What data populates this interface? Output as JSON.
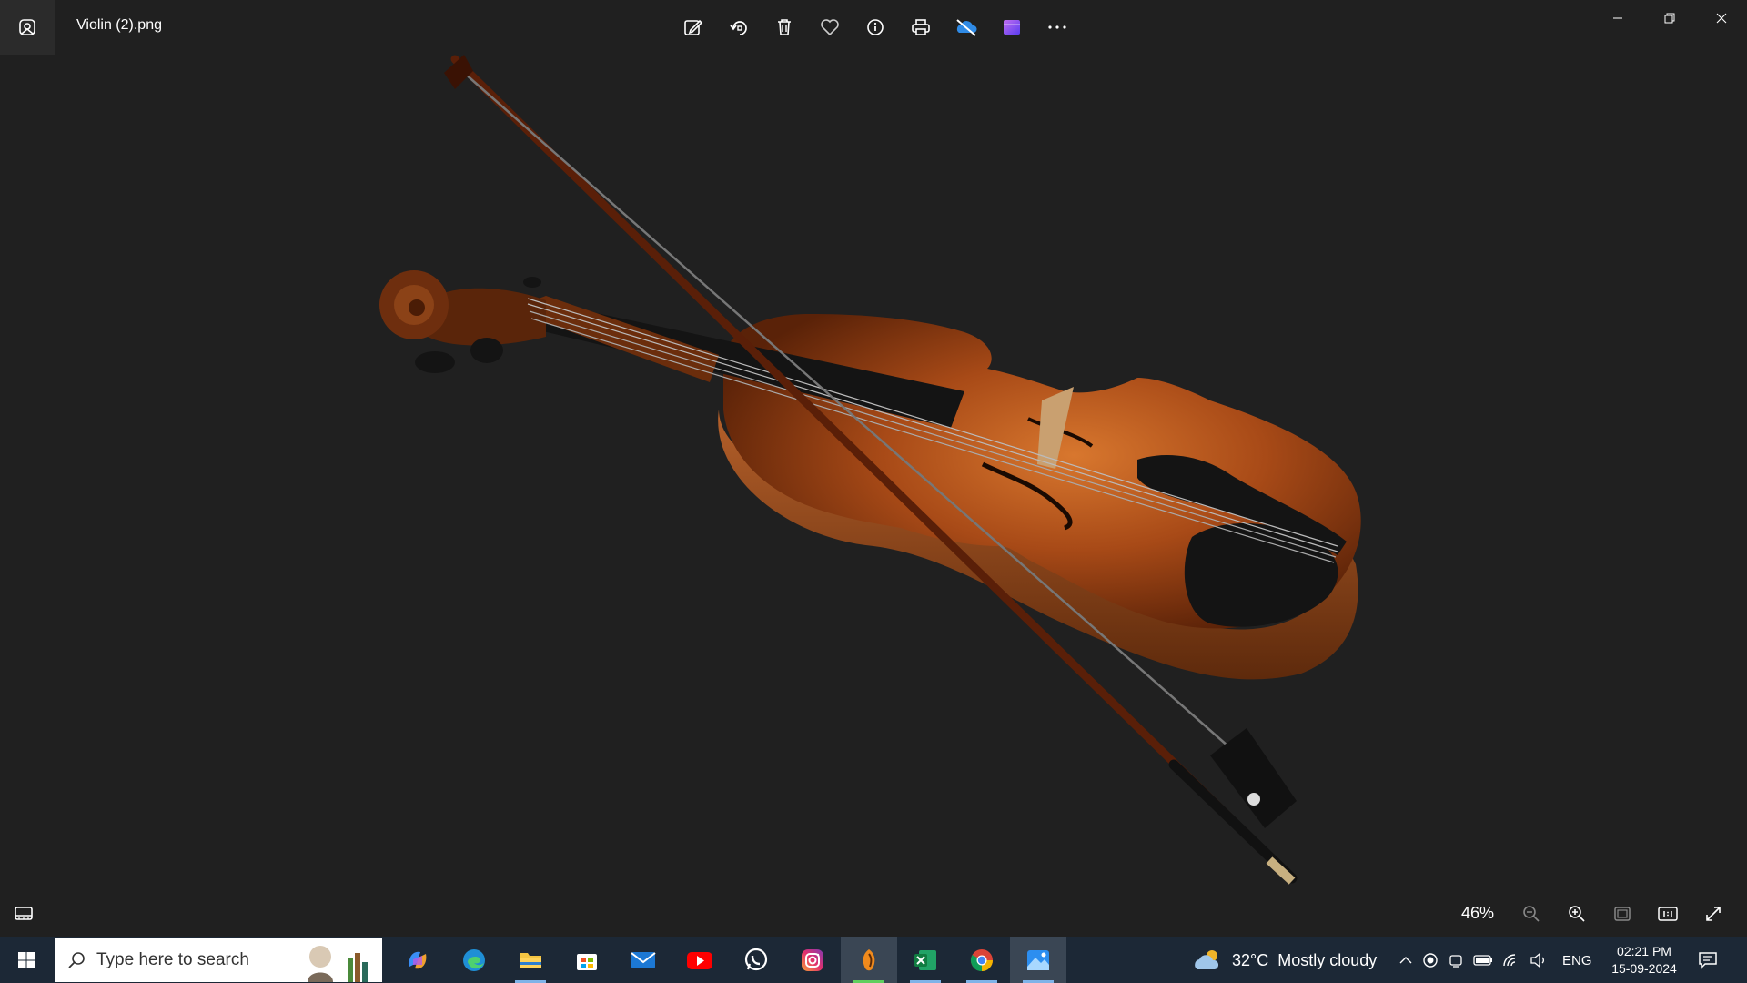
{
  "window": {
    "file_name": "Violin (2).png"
  },
  "toolbar": {
    "buttons": [
      "edit-image",
      "rotate",
      "delete",
      "favorite",
      "file-info",
      "print",
      "onedrive",
      "clipchamp",
      "see-more"
    ]
  },
  "viewer": {
    "zoom_level": "46%",
    "image_subject": "violin-and-bow"
  },
  "taskbar": {
    "search_placeholder": "Type here to search",
    "pinned_apps": [
      "copilot",
      "edge",
      "file-explorer",
      "microsoft-store",
      "mail",
      "youtube",
      "whatsapp",
      "instagram",
      "fl-studio",
      "excel",
      "chrome",
      "photos"
    ],
    "weather": {
      "temperature": "32°C",
      "condition": "Mostly cloudy"
    },
    "language": "ENG",
    "time": "02:21 PM",
    "date": "15-09-2024"
  },
  "colors": {
    "background": "#202020",
    "taskbar": "#1c2836",
    "accent": "#7fb3e8"
  }
}
